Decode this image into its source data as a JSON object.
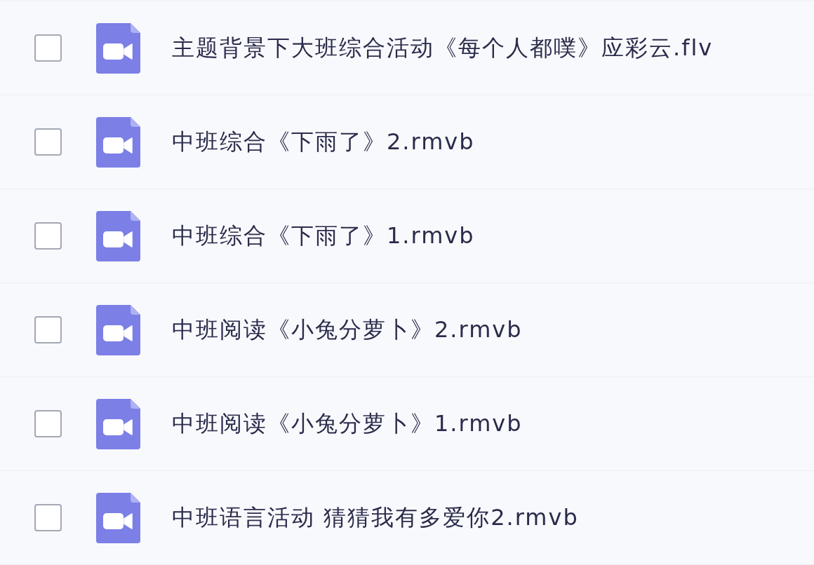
{
  "files": [
    {
      "name": "主题背景下大班综合活动《每个人都噗》应彩云.flv",
      "checked": false
    },
    {
      "name": "中班综合《下雨了》2.rmvb",
      "checked": false
    },
    {
      "name": "中班综合《下雨了》1.rmvb",
      "checked": false
    },
    {
      "name": "中班阅读《小兔分萝卜》2.rmvb",
      "checked": false
    },
    {
      "name": "中班阅读《小兔分萝卜》1.rmvb",
      "checked": false
    },
    {
      "name": "中班语言活动 猜猜我有多爱你2.rmvb",
      "checked": false
    }
  ]
}
